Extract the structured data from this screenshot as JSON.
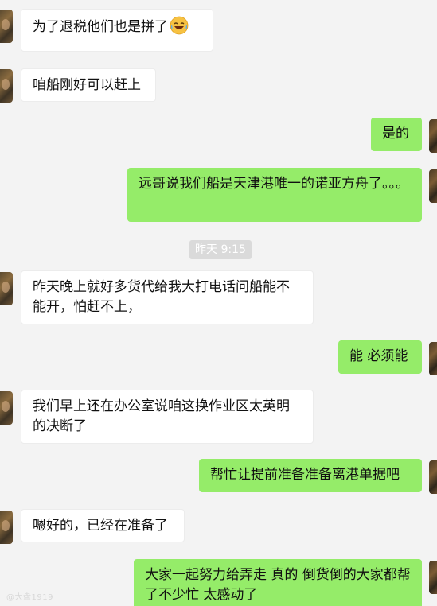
{
  "timestamp": "昨天 9:15",
  "watermark": "@大盘1919",
  "messages": [
    {
      "side": "in",
      "text": "为了退税他们也是拼了",
      "emoji": "laughing-crying-emoji"
    },
    {
      "side": "in",
      "text": "咱船刚好可以赶上"
    },
    {
      "side": "out",
      "text": "是的"
    },
    {
      "side": "out",
      "text": "远哥说我们船是天津港唯一的诺亚方舟了。。。"
    },
    {
      "side": "in",
      "text": "昨天晚上就好多货代给我大打电话问船能不能开，怕赶不上，"
    },
    {
      "side": "out",
      "text": "能 必须能"
    },
    {
      "side": "in",
      "text": "我们早上还在办公室说咱这换作业区太英明的决断了"
    },
    {
      "side": "out",
      "text": "帮忙让提前准备准备离港单据吧"
    },
    {
      "side": "in",
      "text": "嗯好的，已经在准备了"
    },
    {
      "side": "out",
      "text": "大家一起努力给弄走 真的 倒货倒的大家都帮了不少忙 太感动了"
    }
  ],
  "colors": {
    "background": "#f3f3f3",
    "incoming_bubble": "#ffffff",
    "outgoing_bubble": "#95ec69",
    "timestamp_bg": "#dadada"
  }
}
